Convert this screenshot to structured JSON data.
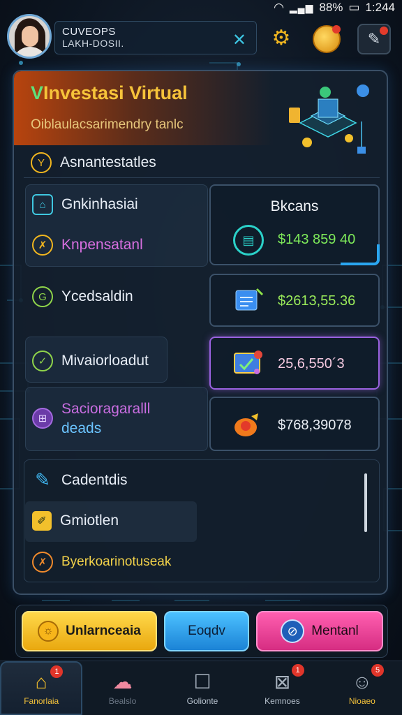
{
  "status_bar": {
    "battery": "88%",
    "time": "1:244"
  },
  "header": {
    "user_name": "CUVEOPS",
    "user_sub": "LAKH-DOSII.",
    "x_icon": "close-x-icon",
    "gear_icon": "gear-icon",
    "coin_icon": "coin-icon",
    "edit_icon": "edit-icon"
  },
  "card": {
    "title_letter": "V",
    "title_rest": "Investasi Virtual",
    "subtitle": "Oiblaulacsarimendry tanlc",
    "row_top": {
      "label": "Asnantestatles"
    },
    "left_items": [
      {
        "label": "Gnkinhasiai",
        "color": "#e6ecf3",
        "icon": "home-icon"
      },
      {
        "label": "Knpensatanl",
        "color": "#d86fe0",
        "icon": "x-circle-icon"
      },
      {
        "label": "Ycedsaldin",
        "color": "#e6ecf3",
        "icon": "g-circle-icon"
      },
      {
        "label": "Mivaiorloadut",
        "color": "#e6ecf3",
        "icon": "check-circle-icon"
      },
      {
        "label": "Sacioragaralll",
        "color": "#c86de0",
        "icon": "purple-circle-icon"
      },
      {
        "label": "deads",
        "color": "#6bc4ff",
        "icon": ""
      }
    ],
    "balance_box": {
      "title": "Bkcans",
      "value": "$143 859 40",
      "icon": "chart-icon"
    },
    "value_boxes": [
      {
        "value": "$2613,55.36",
        "color": "#9aeb5a",
        "icon": "document-icon"
      },
      {
        "value": "25,6,550´3",
        "color": "#f4c9e0",
        "icon": "card-check-icon"
      },
      {
        "value": "$768,39078",
        "color": "#e9eef5",
        "icon": "bag-icon"
      }
    ],
    "bottom_list": [
      {
        "label": "Cadentdis",
        "icon": "pencil-icon"
      },
      {
        "label": "Gmiotlen",
        "icon": "yellow-square-icon"
      },
      {
        "label": "Byerkoarinotuseak",
        "icon": "x-circle-icon"
      }
    ]
  },
  "actions": [
    {
      "label": "Unlarnceaia",
      "icon": "sun-icon"
    },
    {
      "label": "Eoqdv",
      "icon": ""
    },
    {
      "label": "Mentanl",
      "icon": "slash-icon"
    }
  ],
  "bottom_nav": [
    {
      "label": "Fanorlaia",
      "icon": "home-icon",
      "badge": "1",
      "active": true
    },
    {
      "label": "Bealslo",
      "icon": "pig-icon",
      "badge": "",
      "active": false
    },
    {
      "label": "Golionte",
      "icon": "square-icon",
      "badge": "",
      "active": false
    },
    {
      "label": "Kemnoes",
      "icon": "box-x-icon",
      "badge": "1",
      "active": false
    },
    {
      "label": "Nioaeo",
      "icon": "profile-icon",
      "badge": "5",
      "active": false
    }
  ]
}
